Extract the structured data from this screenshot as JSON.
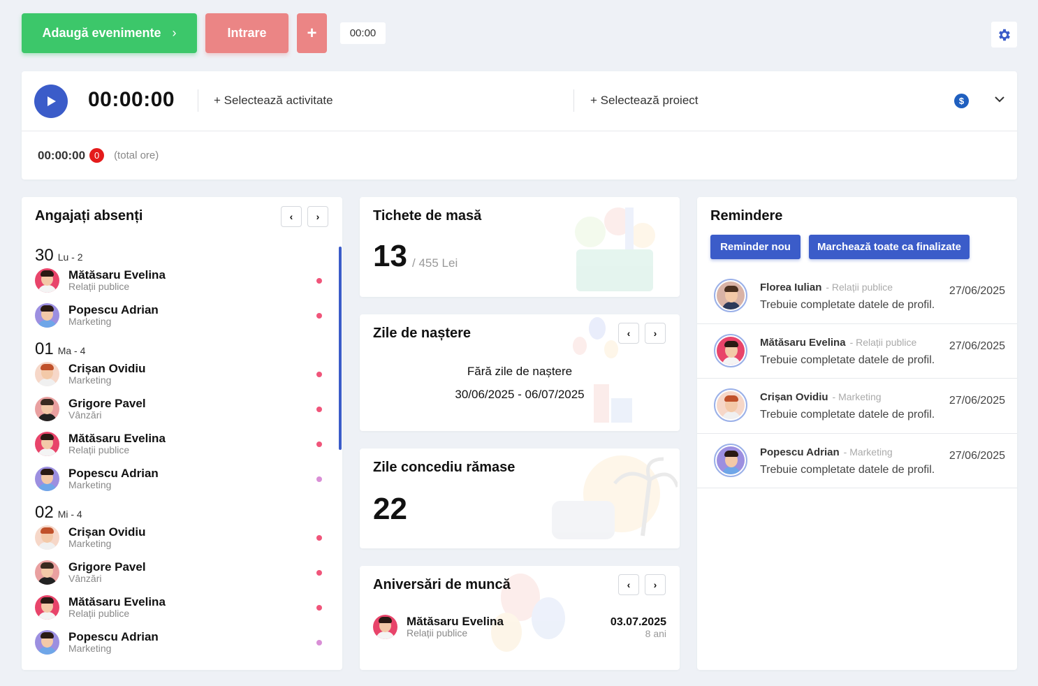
{
  "topbar": {
    "add_events_label": "Adaugă evenimente",
    "chevron": "›",
    "entry_label": "Intrare",
    "plus_label": "+",
    "time_chip": "00:00"
  },
  "timer": {
    "time": "00:00:00",
    "select_activity": "+ Selectează activitate",
    "select_project": "+ Selectează proiect",
    "dollar": "$",
    "total_time": "00:00:00",
    "total_count": "0",
    "total_label": "(total ore)"
  },
  "absent": {
    "title": "Angajați absenți",
    "prev": "‹",
    "next": "›",
    "days": [
      {
        "num": "30",
        "label": "Lu - 2",
        "employees": [
          {
            "name": "Mătăsaru Evelina",
            "dept": "Relații publice"
          },
          {
            "name": "Popescu Adrian",
            "dept": "Marketing"
          }
        ]
      },
      {
        "num": "01",
        "label": "Ma - 4",
        "employees": [
          {
            "name": "Crișan Ovidiu",
            "dept": "Marketing"
          },
          {
            "name": "Grigore Pavel",
            "dept": "Vânzări"
          },
          {
            "name": "Mătăsaru Evelina",
            "dept": "Relații publice"
          },
          {
            "name": "Popescu Adrian",
            "dept": "Marketing"
          }
        ]
      },
      {
        "num": "02",
        "label": "Mi - 4",
        "employees": [
          {
            "name": "Crișan Ovidiu",
            "dept": "Marketing"
          },
          {
            "name": "Grigore Pavel",
            "dept": "Vânzări"
          },
          {
            "name": "Mătăsaru Evelina",
            "dept": "Relații publice"
          },
          {
            "name": "Popescu Adrian",
            "dept": "Marketing"
          }
        ]
      }
    ]
  },
  "meal": {
    "title": "Tichete de masă",
    "count": "13",
    "sub": "/ 455 Lei"
  },
  "birthdays": {
    "title": "Zile de naștere",
    "prev": "‹",
    "next": "›",
    "empty": "Fără zile de naștere",
    "range": "30/06/2025 - 06/07/2025"
  },
  "vacation": {
    "title": "Zile concediu rămase",
    "count": "22"
  },
  "anniversaries": {
    "title": "Aniversări de muncă",
    "prev": "‹",
    "next": "›",
    "name": "Mătăsaru Evelina",
    "dept": "Relații publice",
    "date": "03.07.2025",
    "years": "8 ani"
  },
  "reminders": {
    "title": "Remindere",
    "new_label": "Reminder nou",
    "mark_all_label": "Marchează toate ca finalizate",
    "items": [
      {
        "name": "Florea Iulian",
        "dept": "- Relații publice",
        "msg": "Trebuie completate datele de profil.",
        "date": "27/06/2025"
      },
      {
        "name": "Mătăsaru Evelina",
        "dept": "- Relații publice",
        "msg": "Trebuie completate datele de profil.",
        "date": "27/06/2025"
      },
      {
        "name": "Crișan Ovidiu",
        "dept": "- Marketing",
        "msg": "Trebuie completate datele de profil.",
        "date": "27/06/2025"
      },
      {
        "name": "Popescu Adrian",
        "dept": "- Marketing",
        "msg": "Trebuie completate datele de profil.",
        "date": "27/06/2025"
      }
    ]
  },
  "colors": {
    "green": "#3cc76a",
    "salmon": "#eb8585",
    "primary": "#3b5cc9",
    "badge_red": "#e41b1b",
    "dot_red": "#f0557a",
    "dot_pink": "#d98fd6"
  }
}
